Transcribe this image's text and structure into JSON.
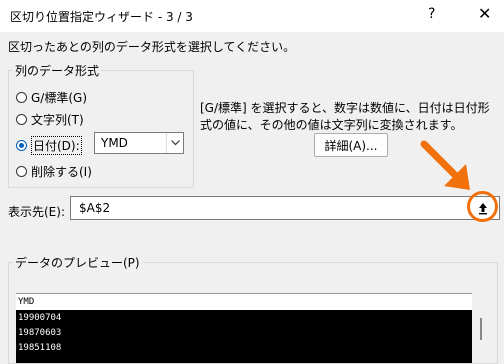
{
  "window": {
    "title": "区切り位置指定ウィザード - 3 / 3",
    "help": "?",
    "close": "✕"
  },
  "instruction": "区切ったあとの列のデータ形式を選択してください。",
  "format_group": {
    "label": "列のデータ形式",
    "options": [
      {
        "label": "G/標準(G)",
        "selected": false
      },
      {
        "label": "文字列(T)",
        "selected": false
      },
      {
        "label": "日付(D):",
        "selected": true
      },
      {
        "label": "削除する(I)",
        "selected": false
      }
    ],
    "date_format": "YMD"
  },
  "description": "[G/標準] を選択すると、数字は数値に、日付は日付形式の値に、その他の値は文字列に変換されます。",
  "detail_button": "詳細(A)...",
  "destination": {
    "label": "表示先(E):",
    "value": "$A$2"
  },
  "preview": {
    "label": "データのプレビュー(P)",
    "header": "YMD",
    "rows": [
      "19900704",
      "19870603",
      "19851108"
    ]
  },
  "colors": {
    "highlight": "#f2700a",
    "accent": "#005fb8"
  }
}
